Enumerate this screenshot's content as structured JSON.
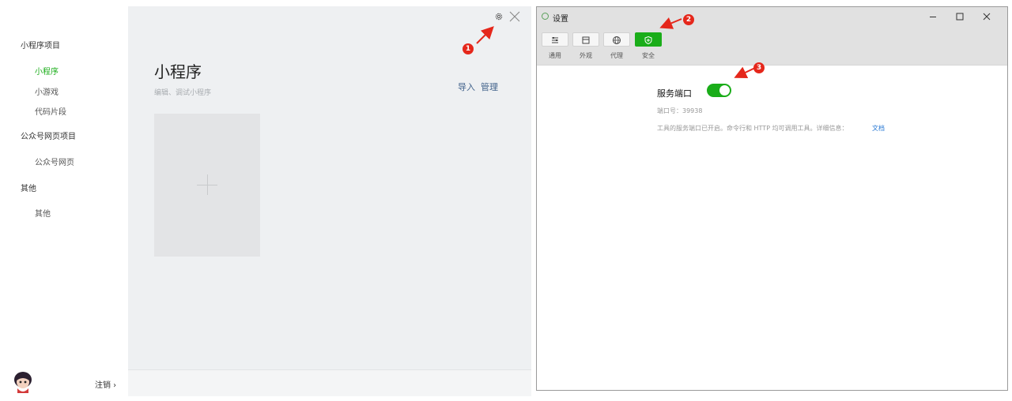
{
  "sidebar": {
    "group_miniprogram": "小程序项目",
    "item_miniprogram": "小程序",
    "item_minigame": "小游戏",
    "item_snippet": "代码片段",
    "group_official": "公众号网页项目",
    "item_official_web": "公众号网页",
    "group_other": "其他",
    "item_other": "其他",
    "logout_label": "注销 ›"
  },
  "main": {
    "title": "小程序",
    "subtitle": "编辑、调试小程序",
    "import_label": "导入",
    "manage_label": "管理"
  },
  "settings": {
    "window_title": "设置",
    "tabs": [
      {
        "label": "通用",
        "icon": "sliders-icon"
      },
      {
        "label": "外观",
        "icon": "layout-icon"
      },
      {
        "label": "代理",
        "icon": "globe-icon"
      },
      {
        "label": "安全",
        "icon": "shield-icon"
      }
    ],
    "active_tab": "安全",
    "service_port_label": "服务端口",
    "service_port_enabled": true,
    "port_text": "端口号：39938",
    "description": "工具的服务端口已开启。命令行和 HTTP 均可调用工具。详细信息：",
    "doc_link": "文档"
  },
  "annotations": {
    "badge_1": "1",
    "badge_2": "2",
    "badge_3": "3"
  },
  "colors": {
    "accent_green": "#1aad19",
    "link_blue": "#41628b",
    "doc_link_blue": "#2a7ad4",
    "annotation_red": "#e5271b"
  }
}
